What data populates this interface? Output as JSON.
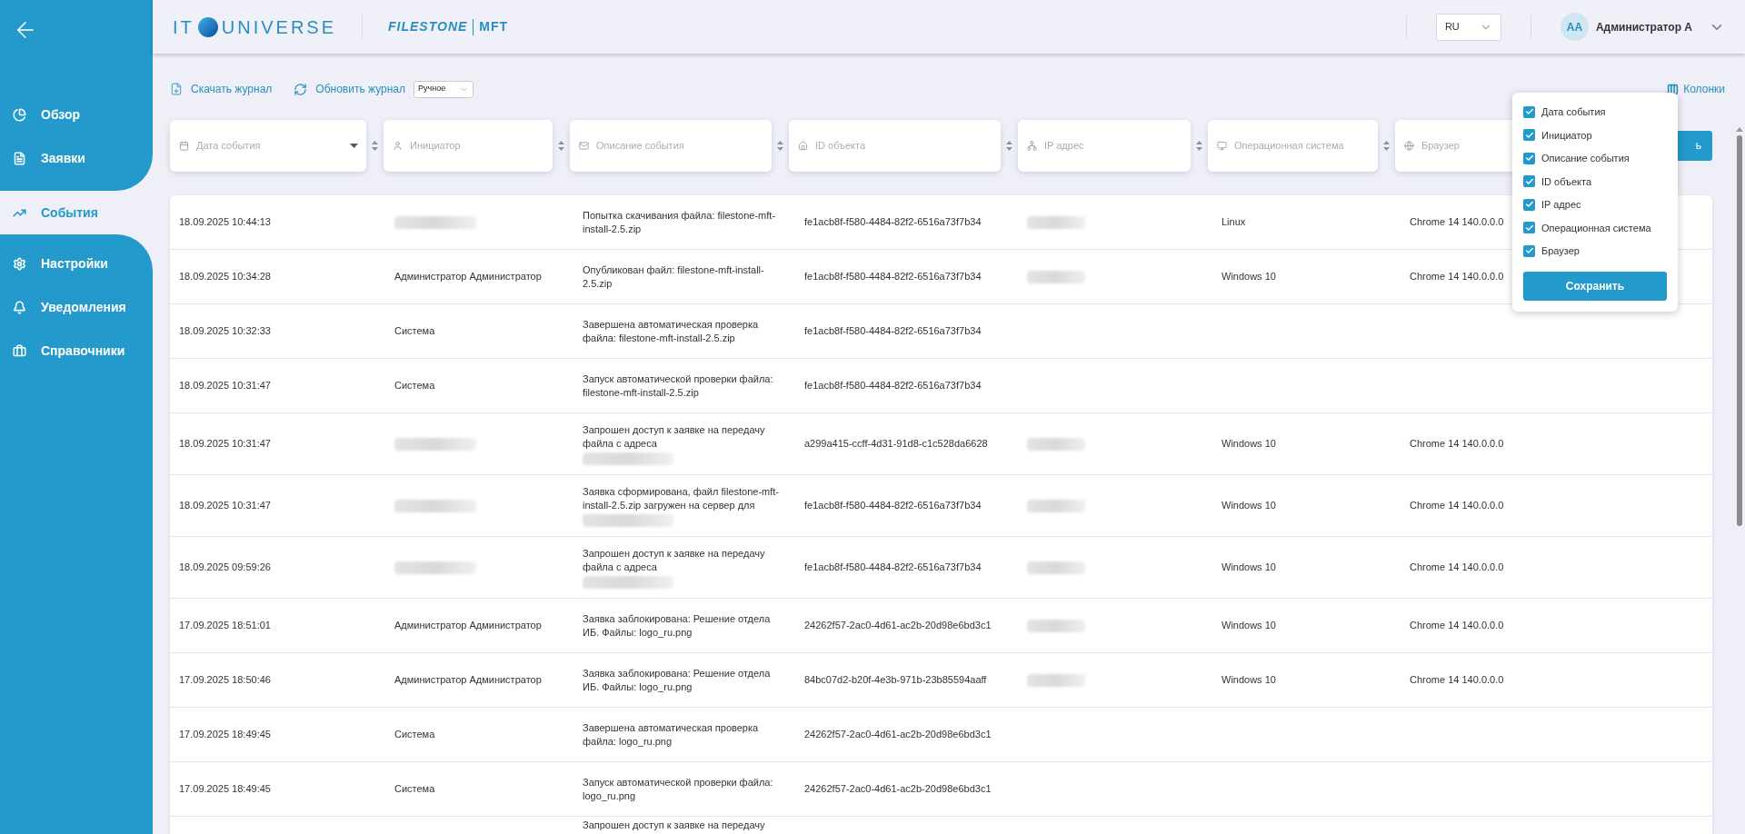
{
  "sidebar": {
    "items": [
      {
        "label": "Обзор",
        "selected": false
      },
      {
        "label": "Заявки",
        "selected": false
      },
      {
        "label": "События",
        "selected": true
      },
      {
        "label": "Настройки",
        "selected": false
      },
      {
        "label": "Уведомления",
        "selected": false
      },
      {
        "label": "Справочники",
        "selected": false
      }
    ]
  },
  "header": {
    "logo_left": "IT",
    "logo_right": "UNIVERSE",
    "product": "FILESTONE",
    "product_suffix": "MFT",
    "language": "RU",
    "user_initials": "AA",
    "user_name": "Администратор А"
  },
  "toolbar": {
    "download": "Скачать журнал",
    "refresh": "Обновить журнал",
    "refresh_mode": "Ручное",
    "columns": "Колонки"
  },
  "filters": [
    {
      "placeholder": "Дата события",
      "kind": "select"
    },
    {
      "placeholder": "Инициатор",
      "kind": "text"
    },
    {
      "placeholder": "Описание события",
      "kind": "text"
    },
    {
      "placeholder": "ID объекта",
      "kind": "text"
    },
    {
      "placeholder": "IP адрес",
      "kind": "text"
    },
    {
      "placeholder": "Операционная система",
      "kind": "text"
    },
    {
      "placeholder": "Браузер",
      "kind": "text"
    }
  ],
  "apply_button": {
    "label": "ь"
  },
  "columns_menu": {
    "items": [
      {
        "label": "Дата события",
        "checked": true
      },
      {
        "label": "Инициатор",
        "checked": true
      },
      {
        "label": "Описание события",
        "checked": true
      },
      {
        "label": "ID объекта",
        "checked": true
      },
      {
        "label": "IP адрес",
        "checked": true
      },
      {
        "label": "Операционная система",
        "checked": true
      },
      {
        "label": "Браузер",
        "checked": true
      }
    ],
    "save": "Сохранить"
  },
  "table": {
    "rows": [
      {
        "date": "18.09.2025 10:44:13",
        "initiator_hidden": true,
        "description": "Попытка скачивания файла: filestone-mft-install-2.5.zip",
        "description_hidden": false,
        "object_id": "fe1acb8f-f580-4484-82f2-6516a73f7b34",
        "ip_hidden": true,
        "os": "Linux",
        "browser": "Chrome 14 140.0.0.0"
      },
      {
        "date": "18.09.2025 10:34:28",
        "initiator": "Администратор Администратор",
        "initiator_hidden": false,
        "description": "Опубликован файл: filestone-mft-install-2.5.zip",
        "description_hidden": false,
        "object_id": "fe1acb8f-f580-4484-82f2-6516a73f7b34",
        "ip_hidden": true,
        "os": "Windows 10",
        "browser": "Chrome 14 140.0.0.0"
      },
      {
        "date": "18.09.2025 10:32:33",
        "initiator": "Система",
        "initiator_hidden": false,
        "description": "Завершена автоматическая проверка файла: filestone-mft-install-2.5.zip",
        "description_hidden": false,
        "object_id": "fe1acb8f-f580-4484-82f2-6516a73f7b34",
        "ip_hidden": false
      },
      {
        "date": "18.09.2025 10:31:47",
        "initiator": "Система",
        "initiator_hidden": false,
        "description": "Запуск автоматической проверки файла: filestone-mft-install-2.5.zip",
        "description_hidden": false,
        "object_id": "fe1acb8f-f580-4484-82f2-6516a73f7b34",
        "ip_hidden": false
      },
      {
        "date": "18.09.2025 10:31:47",
        "initiator_hidden": true,
        "description": "Запрошен доступ к заявке на передачу файла с адреса",
        "description_hidden": true,
        "object_id": "a299a415-ccff-4d31-91d8-c1c528da6628",
        "ip_hidden": true,
        "os": "Windows 10",
        "browser": "Chrome 14 140.0.0.0"
      },
      {
        "date": "18.09.2025 10:31:47",
        "initiator_hidden": true,
        "description": "Заявка сформирована, файл filestone-mft-install-2.5.zip загружен на сервер для",
        "description_hidden": true,
        "object_id": "fe1acb8f-f580-4484-82f2-6516a73f7b34",
        "ip_hidden": true,
        "os": "Windows 10",
        "browser": "Chrome 14 140.0.0.0"
      },
      {
        "date": "18.09.2025 09:59:26",
        "initiator_hidden": true,
        "description": "Запрошен доступ к заявке на передачу файла с адреса",
        "description_hidden": true,
        "object_id": "fe1acb8f-f580-4484-82f2-6516a73f7b34",
        "ip_hidden": true,
        "os": "Windows 10",
        "browser": "Chrome 14 140.0.0.0"
      },
      {
        "date": "17.09.2025 18:51:01",
        "initiator": "Администратор Администратор",
        "initiator_hidden": false,
        "description": "Заявка заблокирована: Решение отдела ИБ. Файлы: logo_ru.png",
        "description_hidden": false,
        "object_id": "24262f57-2ac0-4d61-ac2b-20d98e6bd3c1",
        "ip_hidden": true,
        "os": "Windows 10",
        "browser": "Chrome 14 140.0.0.0"
      },
      {
        "date": "17.09.2025 18:50:46",
        "initiator": "Администратор Администратор",
        "initiator_hidden": false,
        "description": "Заявка заблокирована: Решение отдела ИБ. Файлы: logo_ru.png",
        "description_hidden": false,
        "object_id": "84bc07d2-b20f-4e3b-971b-23b85594aaff",
        "ip_hidden": true,
        "os": "Windows 10",
        "browser": "Chrome 14 140.0.0.0"
      },
      {
        "date": "17.09.2025 18:49:45",
        "initiator": "Система",
        "initiator_hidden": false,
        "description": "Завершена автоматическая проверка файла: logo_ru.png",
        "description_hidden": false,
        "object_id": "24262f57-2ac0-4d61-ac2b-20d98e6bd3c1",
        "ip_hidden": false
      },
      {
        "date": "17.09.2025 18:49:45",
        "initiator": "Система",
        "initiator_hidden": false,
        "description": "Запуск автоматической проверки файла: logo_ru.png",
        "description_hidden": false,
        "object_id": "24262f57-2ac0-4d61-ac2b-20d98e6bd3c1",
        "ip_hidden": false
      },
      {
        "description": "Запрошен доступ к заявке на передачу",
        "description_hidden": false,
        "ip_hidden": false
      }
    ]
  }
}
